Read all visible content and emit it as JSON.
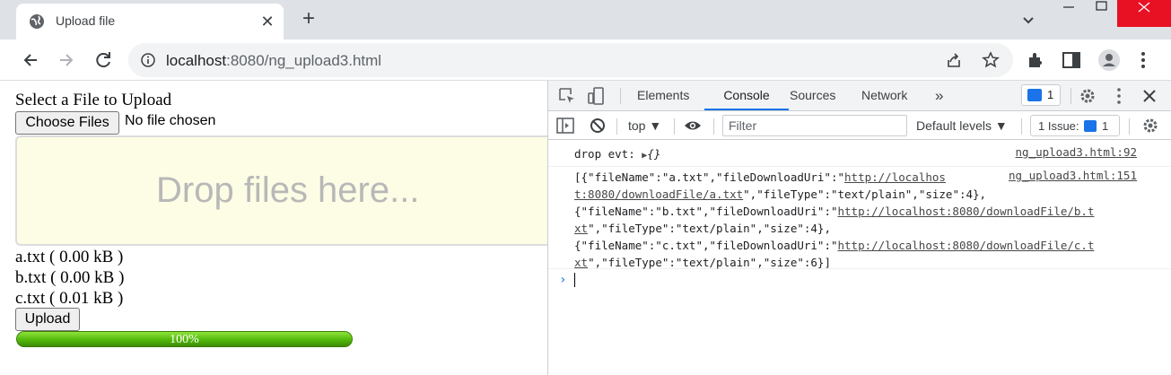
{
  "browser": {
    "tab_title": "Upload file",
    "tab_close": "✕",
    "new_tab": "+",
    "url_host": "localhost",
    "url_rest": ":8080/ng_upload3.html"
  },
  "page": {
    "select_label": "Select a File to Upload",
    "choose_button": "Choose Files",
    "no_file_text": "No file chosen",
    "drop_text": "Drop files here...",
    "files": [
      {
        "name": "a.txt",
        "size_text": "( 0.00 kB )"
      },
      {
        "name": "b.txt",
        "size_text": "( 0.00 kB )"
      },
      {
        "name": "c.txt",
        "size_text": "( 0.01 kB )"
      }
    ],
    "upload_button": "Upload",
    "progress": {
      "percent": 100,
      "label": "100%"
    }
  },
  "devtools": {
    "tabs": [
      "Elements",
      "Console",
      "Sources",
      "Network"
    ],
    "active_tab": "Console",
    "more_tabs": "»",
    "message_badge_count": "1",
    "context": "top ▼",
    "filter_placeholder": "Filter",
    "levels": "Default levels ▼",
    "issues_label": "1 Issue:",
    "issues_count": "1",
    "messages": [
      {
        "text_prefix": "drop evt: ",
        "object_toggle": "▶",
        "object_text": "{}",
        "source": "ng_upload3.html:92"
      },
      {
        "source": "ng_upload3.html:151",
        "lines": [
          {
            "parts": [
              "[{\"fileName\":\"a.txt\",\"fileDownloadUri\":\"",
              "http://localhos"
            ]
          },
          {
            "parts": [
              "t:8080/downloadFile/a.txt",
              "\",\"fileType\":\"text/plain\",\"size\":4},"
            ]
          },
          {
            "parts": [
              "{\"fileName\":\"b.txt\",\"fileDownloadUri\":\"",
              "http://localhost:8080/downloadFile/b.t"
            ]
          },
          {
            "parts": [
              "xt",
              "\",\"fileType\":\"text/plain\",\"size\":4},"
            ]
          },
          {
            "parts": [
              "{\"fileName\":\"c.txt\",\"fileDownloadUri\":\"",
              "http://localhost:8080/downloadFile/c.t"
            ]
          },
          {
            "parts": [
              "xt",
              "\",\"fileType\":\"text/plain\",\"size\":6}]"
            ]
          }
        ]
      }
    ],
    "prompt": "›"
  }
}
